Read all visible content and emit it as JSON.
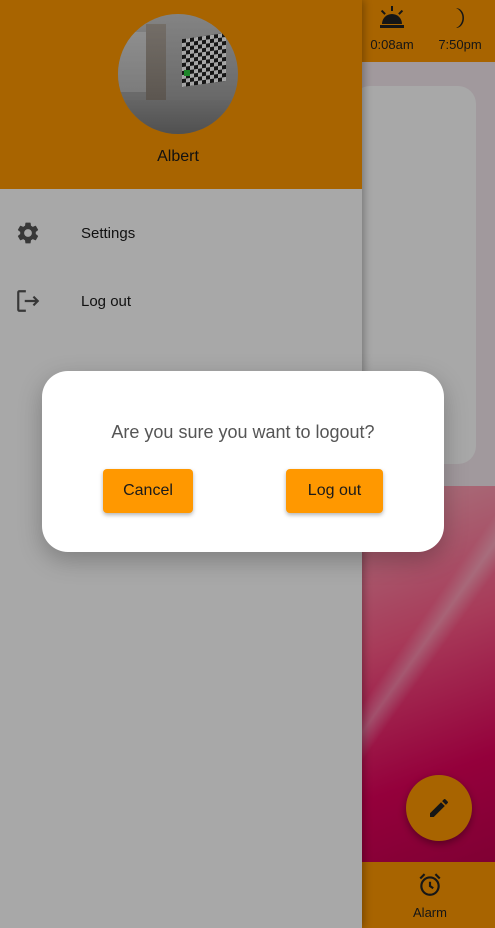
{
  "drawer": {
    "user_name": "Albert",
    "menu": [
      {
        "label": "Settings",
        "icon": "gear-icon"
      },
      {
        "label": "Log out",
        "icon": "logout-icon"
      }
    ]
  },
  "main": {
    "sunrise_time": "0:08am",
    "sunset_time": "7:50pm",
    "bottom_nav": {
      "alarm_label": "Alarm"
    },
    "fab_icon": "pencil-icon"
  },
  "dialog": {
    "message": "Are you sure you want to logout?",
    "cancel_label": "Cancel",
    "confirm_label": "Log out"
  },
  "colors": {
    "accent": "#ff9800",
    "scrim": "rgba(0,0,0,0.34)"
  }
}
